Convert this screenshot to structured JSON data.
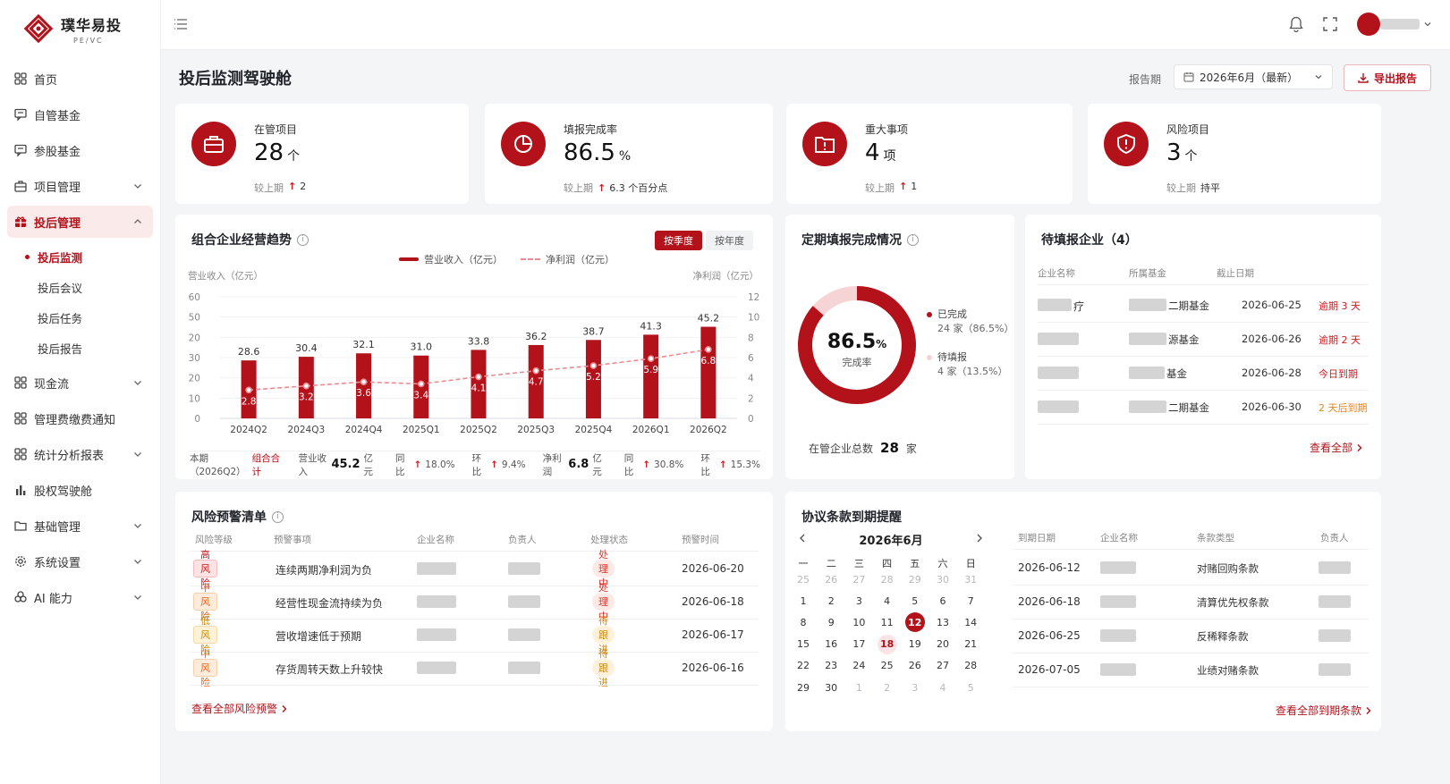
{
  "app": {
    "name": "璞华易投",
    "sub": "PE/VC"
  },
  "sidebar": {
    "items": [
      {
        "label": "首页",
        "icon": "grid-icon",
        "chevron": ""
      },
      {
        "label": "自管基金",
        "icon": "chat-icon",
        "chevron": ""
      },
      {
        "label": "参股基金",
        "icon": "chat-icon",
        "chevron": ""
      },
      {
        "label": "项目管理",
        "icon": "briefcase-icon",
        "chevron": "down"
      },
      {
        "label": "投后管理",
        "icon": "gift-icon",
        "chevron": "up",
        "active": true
      },
      {
        "label": "现金流",
        "icon": "grid-icon",
        "chevron": "down"
      },
      {
        "label": "管理费缴费通知",
        "icon": "grid-icon",
        "chevron": ""
      },
      {
        "label": "统计分析报表",
        "icon": "grid-icon",
        "chevron": "down"
      },
      {
        "label": "股权驾驶舱",
        "icon": "bar-chart-icon",
        "chevron": ""
      },
      {
        "label": "基础管理",
        "icon": "folder-icon",
        "chevron": "down"
      },
      {
        "label": "系统设置",
        "icon": "gear-icon",
        "chevron": "down"
      },
      {
        "label": "AI 能力",
        "icon": "ai-icon",
        "chevron": "down"
      }
    ],
    "subitems": [
      "投后监测",
      "投后会议",
      "投后任务",
      "投后报告"
    ]
  },
  "header": {
    "title": "投后监测驾驶舱",
    "period_label": "报告期",
    "period_value": "2026年6月（最新）",
    "export_label": "导出报告"
  },
  "kpis": [
    {
      "label": "在管项目",
      "value": "28",
      "unit": "个",
      "cmp_label": "较上期",
      "cmp_arrow": "↑",
      "cmp_value": "2",
      "icon": "briefcase-icon"
    },
    {
      "label": "填报完成率",
      "value": "86.5",
      "unit": "%",
      "cmp_label": "较上期",
      "cmp_arrow": "↑",
      "cmp_value": "6.3 个百分点",
      "icon": "pie-icon"
    },
    {
      "label": "重大事项",
      "value": "4",
      "unit": "项",
      "cmp_label": "较上期",
      "cmp_arrow": "↑",
      "cmp_value": "1",
      "icon": "alert-folder-icon"
    },
    {
      "label": "风险项目",
      "value": "3",
      "unit": "个",
      "cmp_label": "较上期",
      "cmp_arrow": "",
      "cmp_value": "持平",
      "icon": "shield-alert-icon"
    }
  ],
  "trend": {
    "title": "组合企业经营趋势",
    "toggle": [
      "按季度",
      "按年度"
    ],
    "legend_bar": "营业收入（亿元）",
    "legend_line": "净利润（亿元）",
    "footer": {
      "period": "本期（2026Q2）",
      "scope": "组合合计",
      "rev_label": "营业收入",
      "rev_value": "45.2",
      "rev_unit": "亿元",
      "yoy_label": "同比",
      "rev_yoy": "18.0%",
      "qoq_label": "环比",
      "rev_qoq": "9.4%",
      "np_label": "净利润",
      "np_value": "6.8",
      "np_unit": "亿元",
      "np_yoy": "30.8%",
      "np_qoq": "15.3%"
    }
  },
  "chart_data": {
    "type": "bar",
    "categories": [
      "2024Q2",
      "2024Q3",
      "2024Q4",
      "2025Q1",
      "2025Q2",
      "2025Q3",
      "2025Q4",
      "2026Q1",
      "2026Q2"
    ],
    "series": [
      {
        "name": "营业收入（亿元）",
        "type": "bar",
        "axis": "left",
        "values": [
          28.6,
          30.4,
          32.1,
          31.0,
          33.8,
          36.2,
          38.7,
          41.3,
          45.2
        ]
      },
      {
        "name": "净利润（亿元）",
        "type": "line",
        "axis": "right",
        "values": [
          2.8,
          3.2,
          3.6,
          3.4,
          4.1,
          4.7,
          5.2,
          5.9,
          6.8
        ]
      }
    ],
    "ylabel": "营业收入（亿元）",
    "y2label": "净利润（亿元）",
    "yticks": [
      0,
      10,
      20,
      30,
      40,
      50,
      60
    ],
    "ytick_labels": [
      "0",
      "10",
      "20",
      "30",
      "20",
      "50",
      "60"
    ],
    "y2ticks": [
      0,
      2,
      4,
      6,
      8,
      10,
      12
    ],
    "ylim": [
      0,
      60
    ],
    "y2lim": [
      0,
      12
    ],
    "colors": {
      "bar": "#b3121b",
      "line": "#ec8c92"
    }
  },
  "completion": {
    "title": "定期填报完成情况",
    "rate": "86.5",
    "rate_unit": "%",
    "rate_label": "完成率",
    "done_label": "已完成",
    "done_detail": "24 家（86.5%）",
    "pending_label": "待填报",
    "pending_detail": "4 家（13.5%）",
    "total_label": "在管企业总数",
    "total_value": "28",
    "total_unit": "家",
    "done_fraction": 0.865
  },
  "pending": {
    "title": "待填报企业（4）",
    "columns": [
      "企业名称",
      "所属基金",
      "截止日期"
    ],
    "rows": [
      {
        "company_tail": "疗",
        "fund_tail": "二期基金",
        "date": "2026-06-25",
        "status": "逾期 3 天",
        "status_color": "#d01920"
      },
      {
        "company_tail": "",
        "fund_tail": "源基金",
        "date": "2026-06-26",
        "status": "逾期 2 天",
        "status_color": "#d01920"
      },
      {
        "company_tail": "",
        "fund_tail": "基金",
        "date": "2026-06-28",
        "status": "今日到期",
        "status_color": "#d01920"
      },
      {
        "company_tail": "",
        "fund_tail": "二期基金",
        "date": "2026-06-30",
        "status": "2 天后到期",
        "status_color": "#e8841f"
      }
    ],
    "view_all": "查看全部"
  },
  "risk": {
    "title": "风险预警清单",
    "columns": [
      "风险等级",
      "预警事项",
      "企业名称",
      "负责人",
      "处理状态",
      "预警时间"
    ],
    "rows": [
      {
        "level": "高风险",
        "level_type": "high",
        "item": "连续两期净利润为负",
        "status": "处理中",
        "status_type": "doing",
        "time": "2026-06-20"
      },
      {
        "level": "中风险",
        "level_type": "mid",
        "item": "经营性现金流持续为负",
        "status": "处理中",
        "status_type": "doing",
        "time": "2026-06-18"
      },
      {
        "level": "低风险",
        "level_type": "low",
        "item": "营收增速低于预期",
        "status": "待跟进",
        "status_type": "todo",
        "time": "2026-06-17"
      },
      {
        "level": "中风险",
        "level_type": "mid",
        "item": "存货周转天数上升较快",
        "status": "待跟进",
        "status_type": "todo",
        "time": "2026-06-16"
      }
    ],
    "view_all": "查看全部风险预警"
  },
  "agreement": {
    "title": "协议条款到期提醒",
    "month": "2026年6月",
    "weekdays": [
      "一",
      "二",
      "三",
      "四",
      "五",
      "六",
      "日"
    ],
    "weeks": [
      [
        [
          "25",
          1
        ],
        [
          "26",
          1
        ],
        [
          "27",
          1
        ],
        [
          "28",
          1
        ],
        [
          "29",
          1
        ],
        [
          "30",
          1
        ],
        [
          "31",
          1
        ]
      ],
      [
        [
          "1",
          0
        ],
        [
          "2",
          0
        ],
        [
          "3",
          0
        ],
        [
          "4",
          0
        ],
        [
          "5",
          0
        ],
        [
          "6",
          0
        ],
        [
          "7",
          0
        ]
      ],
      [
        [
          "8",
          0
        ],
        [
          "9",
          0
        ],
        [
          "10",
          0
        ],
        [
          "11",
          0
        ],
        [
          "12",
          2
        ],
        [
          "13",
          0
        ],
        [
          "14",
          0
        ]
      ],
      [
        [
          "15",
          0
        ],
        [
          "16",
          0
        ],
        [
          "17",
          0
        ],
        [
          "18",
          3
        ],
        [
          "19",
          0
        ],
        [
          "20",
          0
        ],
        [
          "21",
          0
        ]
      ],
      [
        [
          "22",
          0
        ],
        [
          "23",
          0
        ],
        [
          "24",
          0
        ],
        [
          "25",
          0
        ],
        [
          "26",
          0
        ],
        [
          "27",
          0
        ],
        [
          "28",
          0
        ]
      ],
      [
        [
          "29",
          0
        ],
        [
          "30",
          0
        ],
        [
          "1",
          1
        ],
        [
          "2",
          1
        ],
        [
          "3",
          1
        ],
        [
          "4",
          1
        ],
        [
          "5",
          1
        ]
      ]
    ],
    "columns": [
      "到期日期",
      "企业名称",
      "条款类型",
      "负责人"
    ],
    "rows": [
      {
        "date": "2026-06-12",
        "type": "对赌回购条款"
      },
      {
        "date": "2026-06-18",
        "type": "清算优先权条款"
      },
      {
        "date": "2026-06-25",
        "type": "反稀释条款"
      },
      {
        "date": "2026-07-05",
        "type": "业绩对赌条款"
      }
    ],
    "view_all": "查看全部到期条款"
  }
}
